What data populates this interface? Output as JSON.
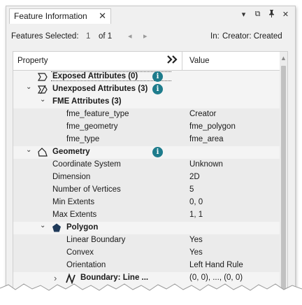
{
  "window": {
    "tab_title": "Feature Information",
    "close_glyph": "✕",
    "controls": [
      "▾",
      "⧉",
      "🖈",
      "✕"
    ]
  },
  "info": {
    "features_selected_label": "Features Selected:",
    "selected_count": "1",
    "of_label": "of 1",
    "prev_glyph": "◂",
    "next_glyph": "▸",
    "in_label": "In:",
    "source": "Creator: Created"
  },
  "table": {
    "col_property": "Property",
    "col_toggle": "»",
    "col_value": "Value",
    "rows": [
      {
        "prop": "Exposed Attributes (0)",
        "value": ""
      },
      {
        "prop": "Unexposed Attributes (3)",
        "value": ""
      },
      {
        "prop": "FME Attributes (3)",
        "value": ""
      },
      {
        "prop": "fme_feature_type",
        "value": "Creator"
      },
      {
        "prop": "fme_geometry",
        "value": "fme_polygon"
      },
      {
        "prop": "fme_type",
        "value": "fme_area"
      },
      {
        "prop": "Geometry",
        "value": ""
      },
      {
        "prop": "Coordinate System",
        "value": "Unknown"
      },
      {
        "prop": "Dimension",
        "value": "2D"
      },
      {
        "prop": "Number of Vertices",
        "value": "5"
      },
      {
        "prop": "Min Extents",
        "value": "0, 0"
      },
      {
        "prop": "Max Extents",
        "value": "1, 1"
      },
      {
        "prop": "Polygon",
        "value": ""
      },
      {
        "prop": "Linear Boundary",
        "value": "Yes"
      },
      {
        "prop": "Convex",
        "value": "Yes"
      },
      {
        "prop": "Orientation",
        "value": "Left Hand Rule"
      },
      {
        "prop": "Boundary: Line ...",
        "value": "(0, 0), ..., (0, 0)"
      }
    ]
  },
  "glyphs": {
    "expanded": "⌄",
    "collapsed": "›",
    "info": "i"
  },
  "colors": {
    "info_badge": "#1e7c8c",
    "highlight_underline": "#d21e1e",
    "polygon_icon": "#1f3a5a"
  }
}
